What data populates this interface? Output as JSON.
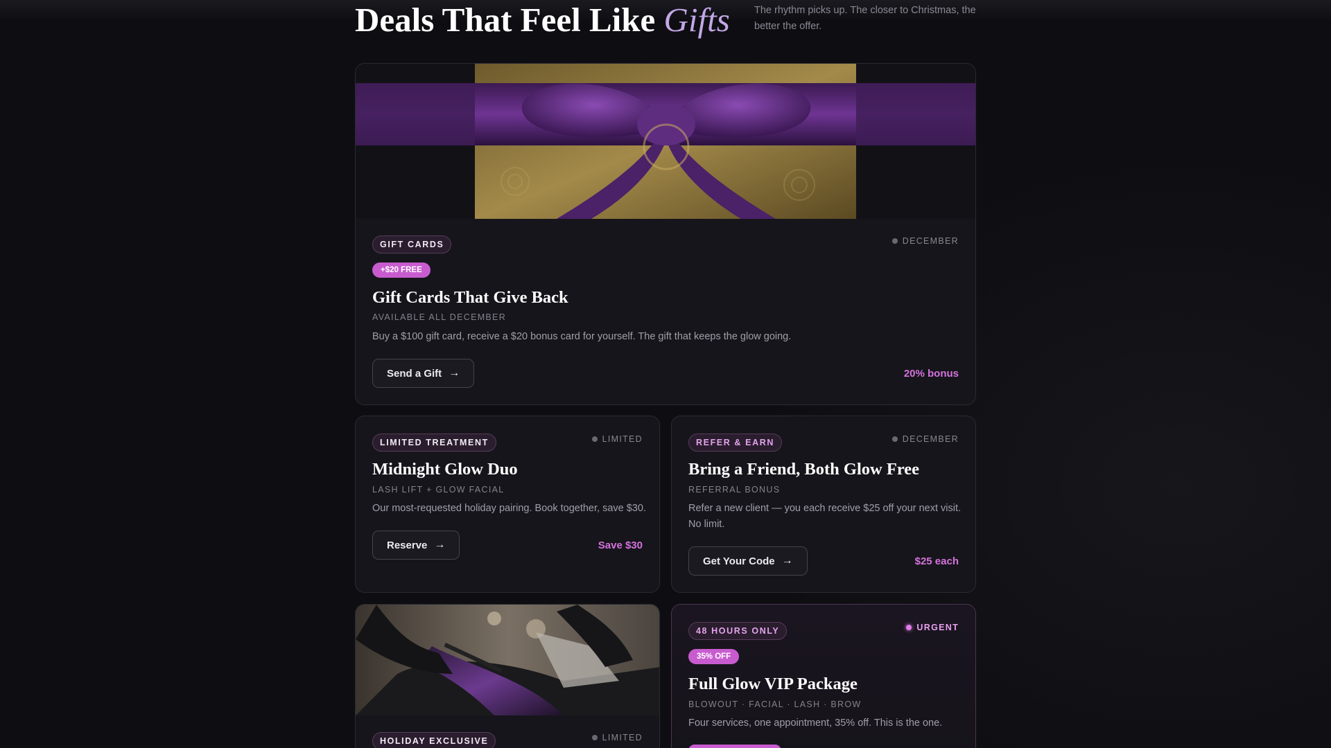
{
  "header": {
    "title_main": "Deals That Feel Like",
    "title_accent": "Gifts",
    "intro": "The rhythm picks up. The closer to Christmas, the better the offer."
  },
  "cards": [
    {
      "pill": "GIFT CARDS",
      "meta": "DECEMBER",
      "tag": "+$20 FREE",
      "title": "Gift Cards That Give Back",
      "subtitle": "AVAILABLE ALL DECEMBER",
      "description": "Buy a $100 gift card, receive a $20 bonus card for yourself. The gift that keeps the glow going.",
      "button": "Send a Gift",
      "price": "20% bonus"
    },
    {
      "pill": "LIMITED TREATMENT",
      "meta": "LIMITED",
      "title": "Midnight Glow Duo",
      "subtitle": "LASH LIFT + GLOW FACIAL",
      "description": "Our most-requested holiday pairing. Book together, save $30.",
      "button": "Reserve",
      "price": "Save $30"
    },
    {
      "pill": "REFER & EARN",
      "meta": "DECEMBER",
      "title": "Bring a Friend, Both Glow Free",
      "subtitle": "REFERRAL BONUS",
      "description": "Refer a new client — you each receive $25 off your next visit. No limit.",
      "button": "Get Your Code",
      "price": "$25 each"
    },
    {
      "pill": "HOLIDAY EXCLUSIVE",
      "meta": "LIMITED"
    },
    {
      "pill": "48 HOURS ONLY",
      "meta": "URGENT",
      "tag": "35% OFF",
      "title": "Full Glow VIP Package",
      "subtitle": "BLOWOUT · FACIAL · LASH · BROW",
      "description": "Four services, one appointment, 35% off. This is the one."
    }
  ],
  "icons": {
    "arrow": "→"
  },
  "colors": {
    "accent": "#c85ccf",
    "accent_text": "#d572dd",
    "background": "#0e0e12",
    "card": "#16151b"
  }
}
